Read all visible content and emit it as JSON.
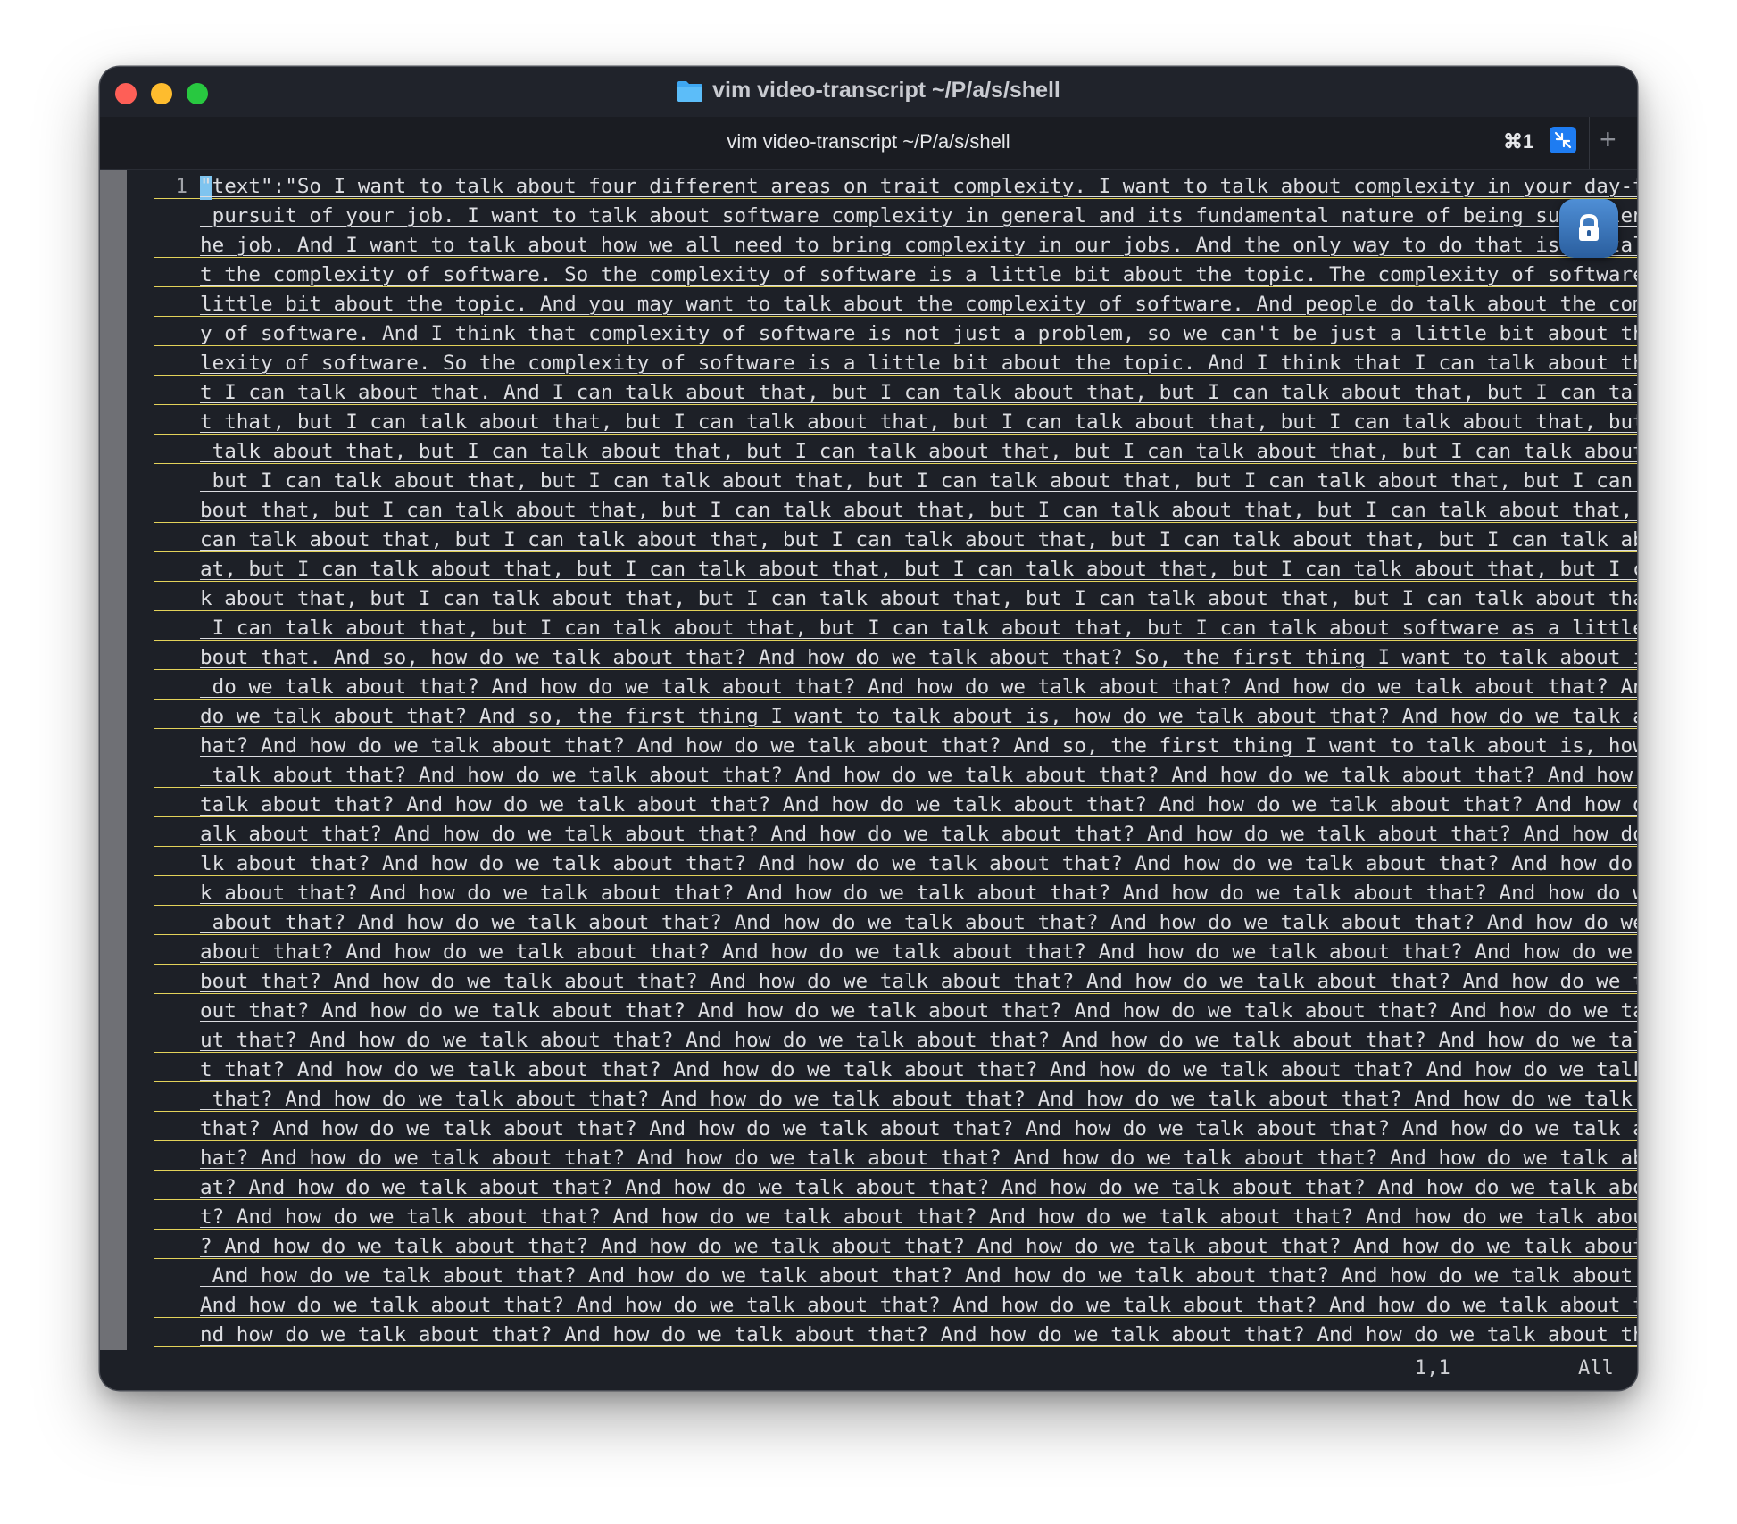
{
  "window": {
    "title": "vim video-transcript ~/P/a/s/shell"
  },
  "tab": {
    "title": "vim video-transcript ~/P/a/s/shell",
    "shortcut": "⌘1",
    "add_label": "+"
  },
  "editor": {
    "line_number": "1",
    "lines": [
      "\"text\":\"So I want to talk about four different areas on trait complexity. I want to talk about complexity in your day-to-day",
      " pursuit of your job. I want to talk about software complexity in general and its fundamental nature of being sufficient t",
      "he job. And I want to talk about how we all need to bring complexity in our jobs. And the only way to do that is to talk abou",
      "t the complexity of software. So the complexity of software is a little bit about the topic. The complexity of software is a ",
      "little bit about the topic. And you may want to talk about the complexity of software. And people do talk about the complexit",
      "y of software. And I think that complexity of software is not just a problem, so we can't be just a little bit about the comp",
      "lexity of software. So the complexity of software is a little bit about the topic. And I think that I can talk about that, bu",
      "t I can talk about that. And I can talk about that, but I can talk about that, but I can talk about that, but I can talk abou",
      "t that, but I can talk about that, but I can talk about that, but I can talk about that, but I can talk about that, but I can",
      " talk about that, but I can talk about that, but I can talk about that, but I can talk about that, but I can talk about that,",
      " but I can talk about that, but I can talk about that, but I can talk about that, but I can talk about that, but I can talk a",
      "bout that, but I can talk about that, but I can talk about that, but I can talk about that, but I can talk about that, but I ",
      "can talk about that, but I can talk about that, but I can talk about that, but I can talk about that, but I can talk about th",
      "at, but I can talk about that, but I can talk about that, but I can talk about that, but I can talk about that, but I can tal",
      "k about that, but I can talk about that, but I can talk about that, but I can talk about that, but I can talk about that, but",
      " I can talk about that, but I can talk about that, but I can talk about that, but I can talk about software as a little bit a",
      "bout that. And so, how do we talk about that? And how do we talk about that? So, the first thing I want to talk about is, how",
      " do we talk about that? And how do we talk about that? And how do we talk about that? And how do we talk about that? And how ",
      "do we talk about that? And so, the first thing I want to talk about is, how do we talk about that? And how do we talk about t",
      "hat? And how do we talk about that? And how do we talk about that? And so, the first thing I want to talk about is, how do we",
      " talk about that? And how do we talk about that? And how do we talk about that? And how do we talk about that? And how do we ",
      "talk about that? And how do we talk about that? And how do we talk about that? And how do we talk about that? And how do we t",
      "alk about that? And how do we talk about that? And how do we talk about that? And how do we talk about that? And how do we ta",
      "lk about that? And how do we talk about that? And how do we talk about that? And how do we talk about that? And how do we tal",
      "k about that? And how do we talk about that? And how do we talk about that? And how do we talk about that? And how do we talk",
      " about that? And how do we talk about that? And how do we talk about that? And how do we talk about that? And how do we talk ",
      "about that? And how do we talk about that? And how do we talk about that? And how do we talk about that? And how do we talk a",
      "bout that? And how do we talk about that? And how do we talk about that? And how do we talk about that? And how do we talk ab",
      "out that? And how do we talk about that? And how do we talk about that? And how do we talk about that? And how do we talk abo",
      "ut that? And how do we talk about that? And how do we talk about that? And how do we talk about that? And how do we talk abou",
      "t that? And how do we talk about that? And how do we talk about that? And how do we talk about that? And how do we talk about",
      " that? And how do we talk about that? And how do we talk about that? And how do we talk about that? And how do we talk about ",
      "that? And how do we talk about that? And how do we talk about that? And how do we talk about that? And how do we talk about t",
      "hat? And how do we talk about that? And how do we talk about that? And how do we talk about that? And how do we talk about th",
      "at? And how do we talk about that? And how do we talk about that? And how do we talk about that? And how do we talk about tha",
      "t? And how do we talk about that? And how do we talk about that? And how do we talk about that? And how do we talk about that",
      "? And how do we talk about that? And how do we talk about that? And how do we talk about that? And how do we talk about that?",
      " And how do we talk about that? And how do we talk about that? And how do we talk about that? And how do we talk about that? ",
      "And how do we talk about that? And how do we talk about that? And how do we talk about that? And how do we talk about that? A",
      "nd how do we talk about that? And how do we talk about that? And how do we talk about that? And how do we talk about that? An"
    ]
  },
  "status": {
    "position": "1,1",
    "scroll": "All"
  },
  "colors": {
    "window_bg": "#1d2027",
    "text": "#dcdde1",
    "underline": "#e3d25a",
    "cursor": "#7fc4ef",
    "tab_badge": "#1e7cf2"
  },
  "icons": {
    "folder": "folder-icon",
    "tab_badge": "broadcast-input-icon",
    "lock": "lock-icon"
  }
}
